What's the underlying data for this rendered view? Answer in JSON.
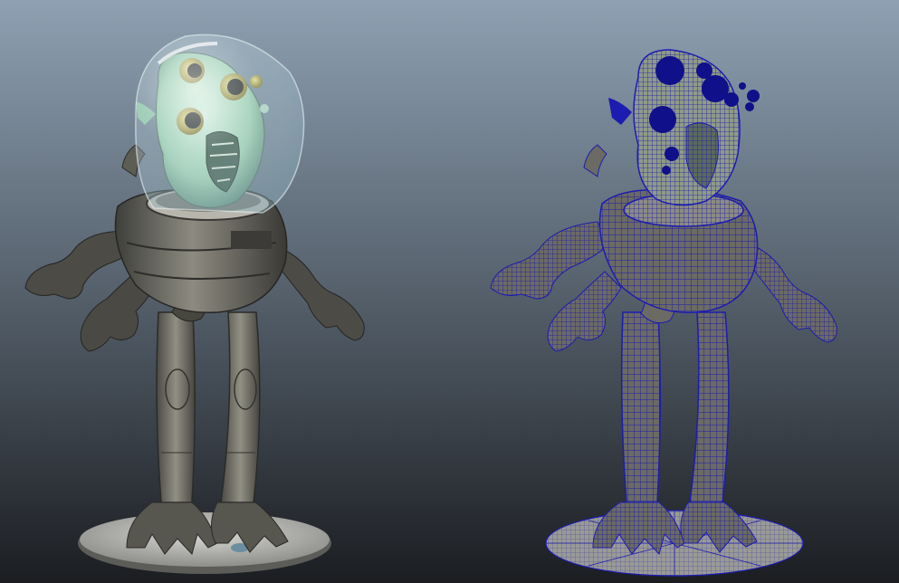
{
  "viewport": {
    "background_top": "#8ea0b2",
    "background_bottom": "#1b1d21"
  },
  "models": [
    {
      "id": "shaded",
      "display_mode": "smooth-shaded",
      "skin_color": "#a6d6b4",
      "suit_color": "#76746a",
      "helmet_color": "#c9dfe4"
    },
    {
      "id": "wireframe",
      "display_mode": "wireframe-on-shaded",
      "wire_color": "#1a1aa8",
      "suit_color": "#6b6a64"
    }
  ]
}
